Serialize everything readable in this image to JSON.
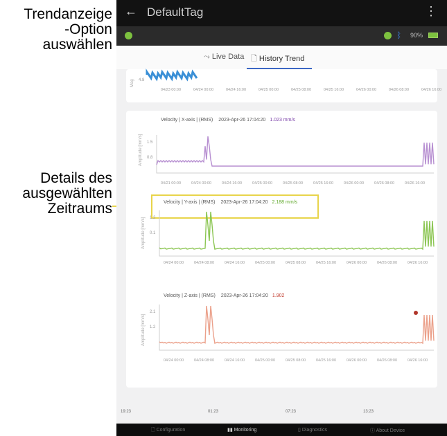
{
  "annotations": {
    "trend_line1": "Trendanzeige",
    "trend_line2": "-Option",
    "trend_line3": "auswählen",
    "details_line1": "Details des",
    "details_line2": "ausgewählten",
    "details_line3": "Zeitraums",
    "color": "#e8d44a"
  },
  "app": {
    "title": "DefaultTag",
    "back_icon": "←",
    "menu_icon": "⋮",
    "battery_label": "90%"
  },
  "tabs": [
    {
      "label": "Live Data",
      "icon": "trend-arrow-icon"
    },
    {
      "label": "History Trend",
      "icon": "document-icon",
      "active": true
    }
  ],
  "top_card": {
    "y_label": "Mag",
    "y_tick": "4.8",
    "x_ticks": [
      "04/23 00:00",
      "04/24 00:00",
      "04/24 16:00",
      "04/25 00:00",
      "04/25 08:00",
      "04/25 16:00",
      "04/26 00:00",
      "04/26 08:00",
      "04/26 16:00"
    ],
    "color": "#3a8fd6"
  },
  "charts": [
    {
      "name": "Velocity | X-axis | (RMS)",
      "timestamp": "2023-Apr-26 17:04:20",
      "value": "1.023 mm/s",
      "value_color": "#7a3ea8",
      "color": "#b78fd1",
      "y_label": "Amplitude [mm/s]",
      "y_ticks": [
        "1.5",
        "0.8"
      ],
      "x_ticks": [
        "04/21 00:00",
        "04/24 00:00",
        "04/24 16:00",
        "04/25 00:00",
        "04/25 08:00",
        "04/25 16:00",
        "04/26 00:00",
        "04/26 08:00",
        "04/26 16:00"
      ]
    },
    {
      "name": "Velocity | Y-axis | (RMS)",
      "timestamp": "2023-Apr-26 17:04:20",
      "value": "2.188 mm/s",
      "value_color": "#5fa82a",
      "color": "#8cc653",
      "y_label": "Amplitude [mm/s]",
      "y_ticks": [
        "1.2",
        "0.1"
      ],
      "x_ticks": [
        "04/24 00:00",
        "04/24 08:00",
        "04/24 16:00",
        "04/25 00:00",
        "04/25 08:00",
        "04/25 16:00",
        "04/26 00:00",
        "04/26 08:00",
        "04/26 16:00"
      ]
    },
    {
      "name": "Velocity | Z-axis | (RMS)",
      "timestamp": "2023-Apr-26 17:04:20",
      "value": "1.902",
      "value_color": "#c0392b",
      "color": "#eba08a",
      "y_label": "Amplitude [mm/s]",
      "y_ticks": [
        "2.1",
        "1.2"
      ],
      "x_ticks": [
        "04/24 00:00",
        "04/24 08:00",
        "04/24 16:00",
        "04/25 00:00",
        "04/25 08:00",
        "04/25 16:00",
        "04/26 00:00",
        "04/26 08:00",
        "04/26 16:00"
      ]
    }
  ],
  "timeline": [
    "19:23",
    "01:23",
    "07:23",
    "13:23"
  ],
  "bottom_nav": [
    {
      "label": "Configuration",
      "icon": "document-icon"
    },
    {
      "label": "Monitoring",
      "icon": "bar-chart-icon",
      "active": true
    },
    {
      "label": "Diagnostics",
      "icon": "clipboard-icon"
    },
    {
      "label": "About Device",
      "icon": "info-icon"
    }
  ]
}
